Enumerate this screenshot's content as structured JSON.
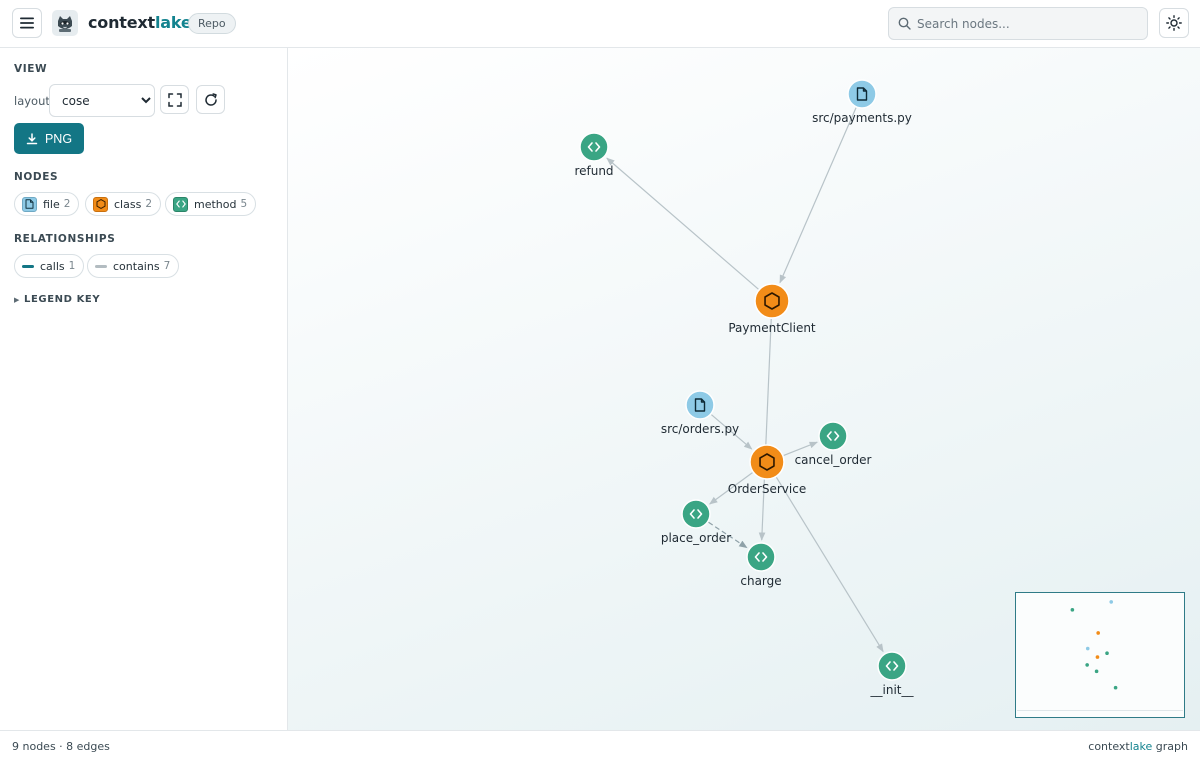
{
  "app": {
    "brand_part1": "context",
    "brand_part2": "lake",
    "badge": "Repo"
  },
  "search": {
    "placeholder": "Search nodes...",
    "value": ""
  },
  "sidebar": {
    "view_title": "VIEW",
    "layout_label": "layout",
    "layout_value": "cose",
    "layout_options": [
      "cose"
    ],
    "png_label": "PNG",
    "nodes_title": "NODES",
    "node_types": [
      {
        "label": "file",
        "count": "2",
        "color": "#8ecae6",
        "icon": "file-icon"
      },
      {
        "label": "class",
        "count": "2",
        "color": "#f28c18",
        "icon": "hexagon-icon"
      },
      {
        "label": "method",
        "count": "5",
        "color": "#3aa584",
        "icon": "code-icon"
      }
    ],
    "relationships_title": "RELATIONSHIPS",
    "relationships": [
      {
        "label": "calls",
        "count": "1",
        "color": "#137685"
      },
      {
        "label": "contains",
        "count": "7",
        "color": "#b3bcc1"
      }
    ],
    "legend_key": "LEGEND KEY"
  },
  "graph": {
    "colors": {
      "file": "#8ecae6",
      "class": "#f28c18",
      "method": "#3aa584",
      "edge": "#b8c3c8"
    },
    "nodes": [
      {
        "id": "payments",
        "label": "src/payments.py",
        "type": "file"
      },
      {
        "id": "refund",
        "label": "refund",
        "type": "method"
      },
      {
        "id": "paymentclient",
        "label": "PaymentClient",
        "type": "class"
      },
      {
        "id": "orders",
        "label": "src/orders.py",
        "type": "file"
      },
      {
        "id": "cancel_order",
        "label": "cancel_order",
        "type": "method"
      },
      {
        "id": "orderservice",
        "label": "OrderService",
        "type": "class"
      },
      {
        "id": "place_order",
        "label": "place_order",
        "type": "method"
      },
      {
        "id": "charge",
        "label": "charge",
        "type": "method"
      },
      {
        "id": "init",
        "label": "__init__",
        "type": "method"
      }
    ],
    "edges": [
      {
        "from": "payments",
        "to": "paymentclient",
        "type": "contains"
      },
      {
        "from": "paymentclient",
        "to": "refund",
        "type": "contains"
      },
      {
        "from": "paymentclient",
        "to": "charge",
        "type": "contains"
      },
      {
        "from": "orders",
        "to": "orderservice",
        "type": "contains"
      },
      {
        "from": "orderservice",
        "to": "cancel_order",
        "type": "contains"
      },
      {
        "from": "orderservice",
        "to": "place_order",
        "type": "contains"
      },
      {
        "from": "orderservice",
        "to": "init",
        "type": "contains"
      },
      {
        "from": "place_order",
        "to": "charge",
        "type": "calls"
      }
    ]
  },
  "footer": {
    "stats": "9 nodes · 8 edges",
    "brand_part1": "context",
    "brand_part2": "lake",
    "suffix": " graph"
  }
}
